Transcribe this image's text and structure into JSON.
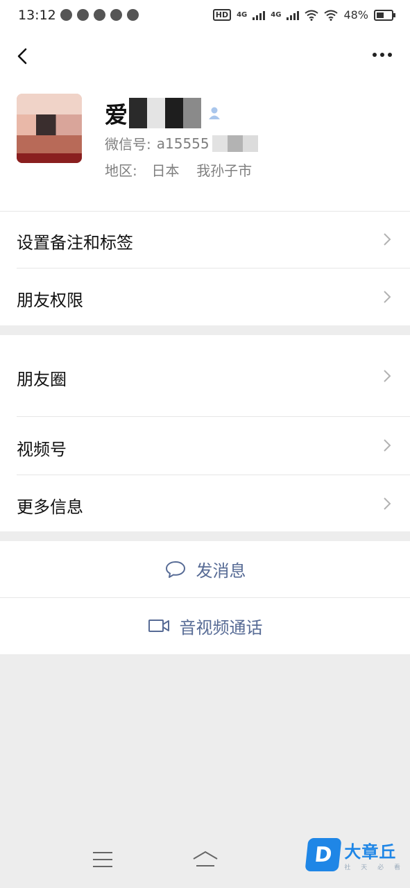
{
  "status_bar": {
    "time": "13:12",
    "hd_label": "HD",
    "network_1": "4G",
    "network_2": "4G",
    "battery": "48%"
  },
  "profile": {
    "name_visible": "爱",
    "wechat_id_label": "微信号:",
    "wechat_id_visible": "a15555",
    "region_label": "地区:",
    "region_country": "日本",
    "region_city": "我孙子市"
  },
  "menu": {
    "group1": [
      {
        "label": "设置备注和标签"
      },
      {
        "label": "朋友权限"
      }
    ],
    "group2": [
      {
        "label": "朋友圈"
      },
      {
        "label": "视频号"
      },
      {
        "label": "更多信息"
      }
    ]
  },
  "actions": {
    "send_message": "发消息",
    "av_call": "音视频通话"
  },
  "watermark": {
    "logo_letter": "D",
    "name": "大章丘",
    "subtitle": "社 天 必 看"
  },
  "colors": {
    "accent_link": "#576b95",
    "background": "#ededed",
    "watermark_blue": "#1f86e6"
  },
  "icons": [
    "back-arrow-icon",
    "more-dots-icon",
    "person-icon",
    "chevron-right-icon",
    "chat-bubble-icon",
    "video-camera-icon",
    "menu-icon",
    "home-icon"
  ]
}
